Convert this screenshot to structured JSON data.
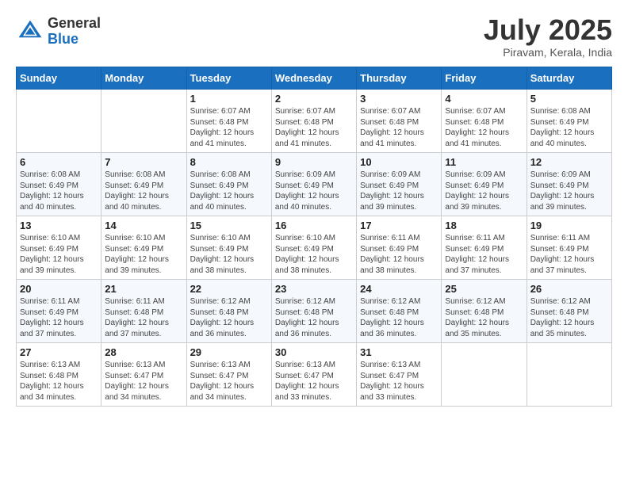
{
  "header": {
    "logo": {
      "general": "General",
      "blue": "Blue"
    },
    "title": "July 2025",
    "location": "Piravam, Kerala, India"
  },
  "calendar": {
    "weekdays": [
      "Sunday",
      "Monday",
      "Tuesday",
      "Wednesday",
      "Thursday",
      "Friday",
      "Saturday"
    ],
    "weeks": [
      [
        {
          "day": "",
          "sunrise": "",
          "sunset": "",
          "daylight": ""
        },
        {
          "day": "",
          "sunrise": "",
          "sunset": "",
          "daylight": ""
        },
        {
          "day": "1",
          "sunrise": "Sunrise: 6:07 AM",
          "sunset": "Sunset: 6:48 PM",
          "daylight": "Daylight: 12 hours and 41 minutes."
        },
        {
          "day": "2",
          "sunrise": "Sunrise: 6:07 AM",
          "sunset": "Sunset: 6:48 PM",
          "daylight": "Daylight: 12 hours and 41 minutes."
        },
        {
          "day": "3",
          "sunrise": "Sunrise: 6:07 AM",
          "sunset": "Sunset: 6:48 PM",
          "daylight": "Daylight: 12 hours and 41 minutes."
        },
        {
          "day": "4",
          "sunrise": "Sunrise: 6:07 AM",
          "sunset": "Sunset: 6:48 PM",
          "daylight": "Daylight: 12 hours and 41 minutes."
        },
        {
          "day": "5",
          "sunrise": "Sunrise: 6:08 AM",
          "sunset": "Sunset: 6:49 PM",
          "daylight": "Daylight: 12 hours and 40 minutes."
        }
      ],
      [
        {
          "day": "6",
          "sunrise": "Sunrise: 6:08 AM",
          "sunset": "Sunset: 6:49 PM",
          "daylight": "Daylight: 12 hours and 40 minutes."
        },
        {
          "day": "7",
          "sunrise": "Sunrise: 6:08 AM",
          "sunset": "Sunset: 6:49 PM",
          "daylight": "Daylight: 12 hours and 40 minutes."
        },
        {
          "day": "8",
          "sunrise": "Sunrise: 6:08 AM",
          "sunset": "Sunset: 6:49 PM",
          "daylight": "Daylight: 12 hours and 40 minutes."
        },
        {
          "day": "9",
          "sunrise": "Sunrise: 6:09 AM",
          "sunset": "Sunset: 6:49 PM",
          "daylight": "Daylight: 12 hours and 40 minutes."
        },
        {
          "day": "10",
          "sunrise": "Sunrise: 6:09 AM",
          "sunset": "Sunset: 6:49 PM",
          "daylight": "Daylight: 12 hours and 39 minutes."
        },
        {
          "day": "11",
          "sunrise": "Sunrise: 6:09 AM",
          "sunset": "Sunset: 6:49 PM",
          "daylight": "Daylight: 12 hours and 39 minutes."
        },
        {
          "day": "12",
          "sunrise": "Sunrise: 6:09 AM",
          "sunset": "Sunset: 6:49 PM",
          "daylight": "Daylight: 12 hours and 39 minutes."
        }
      ],
      [
        {
          "day": "13",
          "sunrise": "Sunrise: 6:10 AM",
          "sunset": "Sunset: 6:49 PM",
          "daylight": "Daylight: 12 hours and 39 minutes."
        },
        {
          "day": "14",
          "sunrise": "Sunrise: 6:10 AM",
          "sunset": "Sunset: 6:49 PM",
          "daylight": "Daylight: 12 hours and 39 minutes."
        },
        {
          "day": "15",
          "sunrise": "Sunrise: 6:10 AM",
          "sunset": "Sunset: 6:49 PM",
          "daylight": "Daylight: 12 hours and 38 minutes."
        },
        {
          "day": "16",
          "sunrise": "Sunrise: 6:10 AM",
          "sunset": "Sunset: 6:49 PM",
          "daylight": "Daylight: 12 hours and 38 minutes."
        },
        {
          "day": "17",
          "sunrise": "Sunrise: 6:11 AM",
          "sunset": "Sunset: 6:49 PM",
          "daylight": "Daylight: 12 hours and 38 minutes."
        },
        {
          "day": "18",
          "sunrise": "Sunrise: 6:11 AM",
          "sunset": "Sunset: 6:49 PM",
          "daylight": "Daylight: 12 hours and 37 minutes."
        },
        {
          "day": "19",
          "sunrise": "Sunrise: 6:11 AM",
          "sunset": "Sunset: 6:49 PM",
          "daylight": "Daylight: 12 hours and 37 minutes."
        }
      ],
      [
        {
          "day": "20",
          "sunrise": "Sunrise: 6:11 AM",
          "sunset": "Sunset: 6:49 PM",
          "daylight": "Daylight: 12 hours and 37 minutes."
        },
        {
          "day": "21",
          "sunrise": "Sunrise: 6:11 AM",
          "sunset": "Sunset: 6:48 PM",
          "daylight": "Daylight: 12 hours and 37 minutes."
        },
        {
          "day": "22",
          "sunrise": "Sunrise: 6:12 AM",
          "sunset": "Sunset: 6:48 PM",
          "daylight": "Daylight: 12 hours and 36 minutes."
        },
        {
          "day": "23",
          "sunrise": "Sunrise: 6:12 AM",
          "sunset": "Sunset: 6:48 PM",
          "daylight": "Daylight: 12 hours and 36 minutes."
        },
        {
          "day": "24",
          "sunrise": "Sunrise: 6:12 AM",
          "sunset": "Sunset: 6:48 PM",
          "daylight": "Daylight: 12 hours and 36 minutes."
        },
        {
          "day": "25",
          "sunrise": "Sunrise: 6:12 AM",
          "sunset": "Sunset: 6:48 PM",
          "daylight": "Daylight: 12 hours and 35 minutes."
        },
        {
          "day": "26",
          "sunrise": "Sunrise: 6:12 AM",
          "sunset": "Sunset: 6:48 PM",
          "daylight": "Daylight: 12 hours and 35 minutes."
        }
      ],
      [
        {
          "day": "27",
          "sunrise": "Sunrise: 6:13 AM",
          "sunset": "Sunset: 6:48 PM",
          "daylight": "Daylight: 12 hours and 34 minutes."
        },
        {
          "day": "28",
          "sunrise": "Sunrise: 6:13 AM",
          "sunset": "Sunset: 6:47 PM",
          "daylight": "Daylight: 12 hours and 34 minutes."
        },
        {
          "day": "29",
          "sunrise": "Sunrise: 6:13 AM",
          "sunset": "Sunset: 6:47 PM",
          "daylight": "Daylight: 12 hours and 34 minutes."
        },
        {
          "day": "30",
          "sunrise": "Sunrise: 6:13 AM",
          "sunset": "Sunset: 6:47 PM",
          "daylight": "Daylight: 12 hours and 33 minutes."
        },
        {
          "day": "31",
          "sunrise": "Sunrise: 6:13 AM",
          "sunset": "Sunset: 6:47 PM",
          "daylight": "Daylight: 12 hours and 33 minutes."
        },
        {
          "day": "",
          "sunrise": "",
          "sunset": "",
          "daylight": ""
        },
        {
          "day": "",
          "sunrise": "",
          "sunset": "",
          "daylight": ""
        }
      ]
    ]
  }
}
